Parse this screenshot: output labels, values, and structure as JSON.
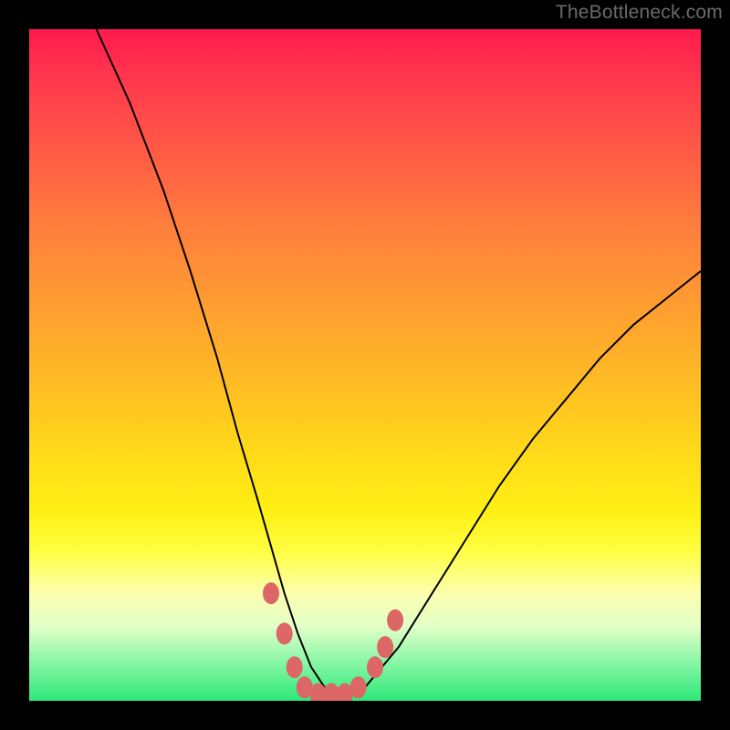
{
  "watermark": "TheBottleneck.com",
  "chart_data": {
    "type": "line",
    "title": "",
    "xlabel": "",
    "ylabel": "",
    "xlim": [
      0,
      100
    ],
    "ylim": [
      0,
      100
    ],
    "grid": false,
    "legend": false,
    "series": [
      {
        "name": "bottleneck-curve",
        "x": [
          10,
          15,
          20,
          24,
          28,
          31,
          34,
          36,
          38,
          40,
          42,
          44,
          46,
          48,
          50,
          55,
          60,
          65,
          70,
          75,
          80,
          85,
          90,
          95,
          100
        ],
        "y": [
          100,
          89,
          76,
          64,
          51,
          40,
          30,
          23,
          16,
          10,
          5,
          2,
          1,
          1,
          2,
          8,
          16,
          24,
          32,
          39,
          45,
          51,
          56,
          60,
          64
        ],
        "color": "#000000",
        "stroke_width": 2
      }
    ],
    "markers": [
      {
        "name": "threshold-dots",
        "color": "#dd6666",
        "points": [
          {
            "x": 36,
            "y": 16
          },
          {
            "x": 38,
            "y": 10
          },
          {
            "x": 39.5,
            "y": 5
          },
          {
            "x": 41,
            "y": 2
          },
          {
            "x": 43,
            "y": 1
          },
          {
            "x": 45,
            "y": 1
          },
          {
            "x": 47,
            "y": 1
          },
          {
            "x": 49,
            "y": 2
          },
          {
            "x": 51.5,
            "y": 5
          },
          {
            "x": 53,
            "y": 8
          },
          {
            "x": 54.5,
            "y": 12
          }
        ]
      }
    ],
    "background_gradient": {
      "type": "rainbow-vertical",
      "stops": [
        {
          "pos": 0.0,
          "color": "#ff1a4d"
        },
        {
          "pos": 0.5,
          "color": "#ffba25"
        },
        {
          "pos": 0.78,
          "color": "#ffff45"
        },
        {
          "pos": 1.0,
          "color": "#2ee87a"
        }
      ]
    }
  }
}
